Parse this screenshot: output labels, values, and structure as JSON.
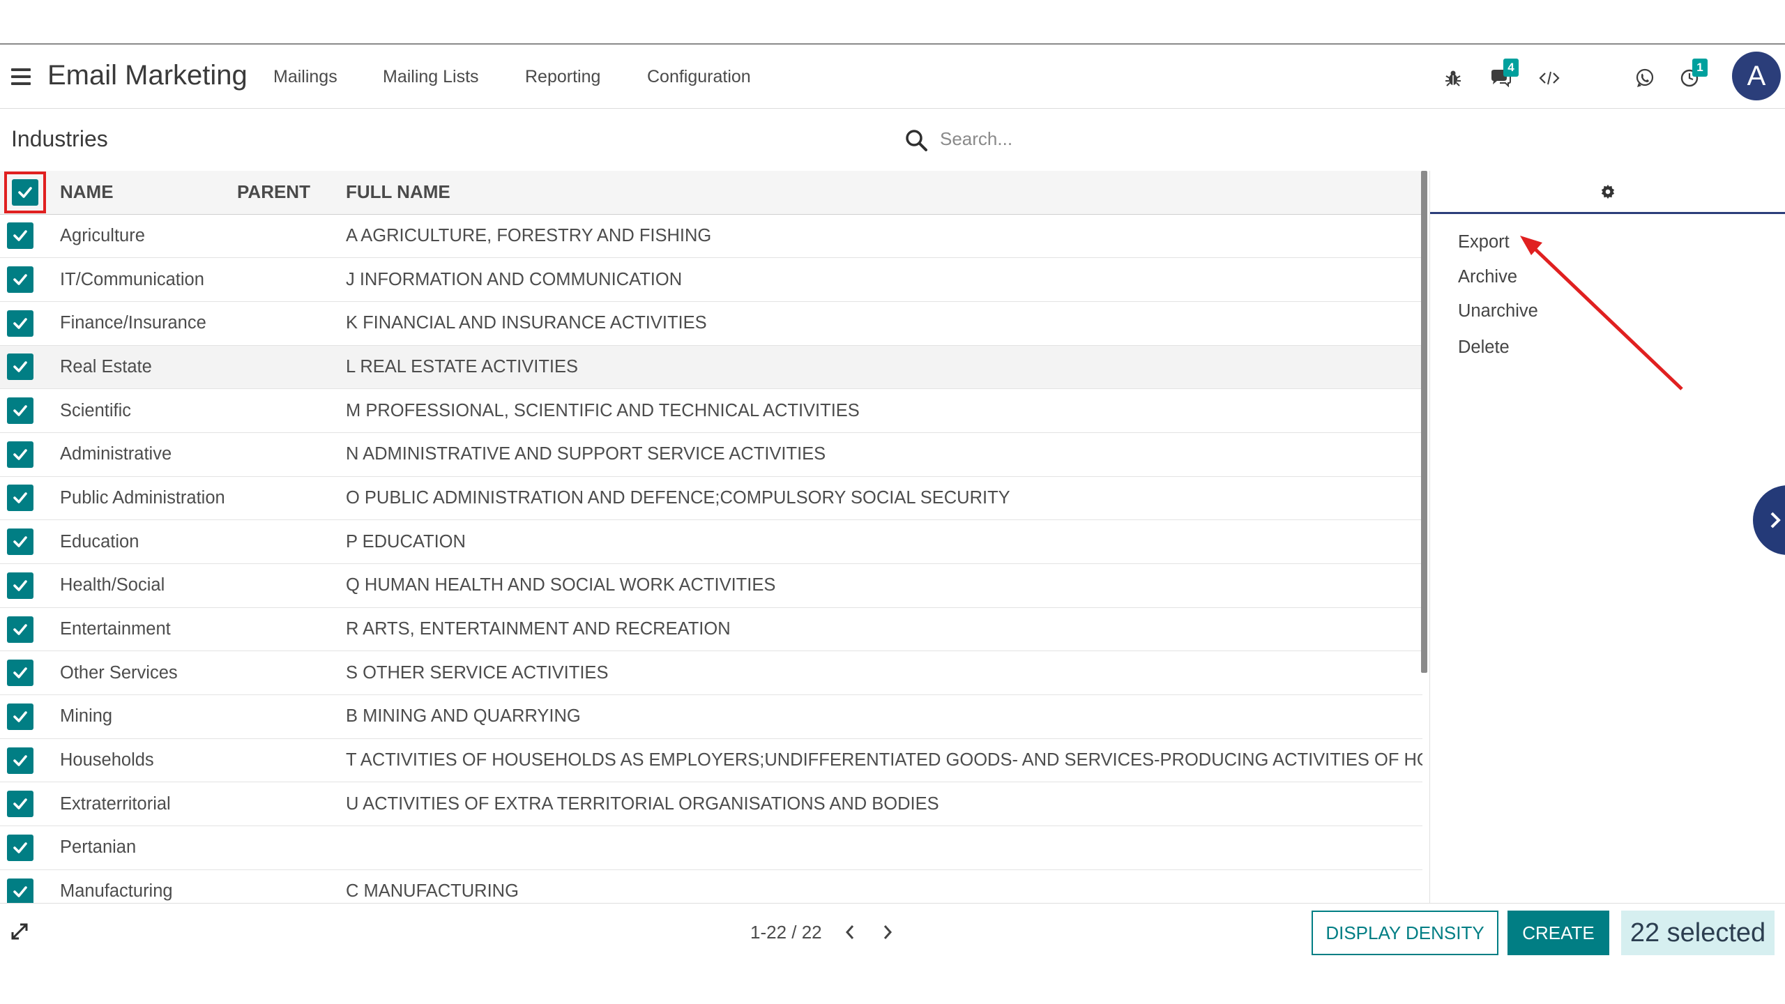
{
  "navbar": {
    "app_title": "Email Marketing",
    "menu": [
      "Mailings",
      "Mailing Lists",
      "Reporting",
      "Configuration"
    ],
    "chat_badge": "4",
    "activity_badge": "1",
    "avatar_letter": "A",
    "icons": [
      "bug-icon",
      "chat-icon",
      "code-icon",
      "whatsapp-icon",
      "clock-icon"
    ]
  },
  "control_panel": {
    "title": "Industries",
    "search_placeholder": "Search..."
  },
  "table": {
    "columns": [
      "NAME",
      "PARENT",
      "FULL NAME"
    ],
    "rows": [
      {
        "name": "Agriculture",
        "parent": "",
        "full_name": "A AGRICULTURE, FORESTRY AND FISHING"
      },
      {
        "name": "IT/Communication",
        "parent": "",
        "full_name": "J INFORMATION AND COMMUNICATION"
      },
      {
        "name": "Finance/Insurance",
        "parent": "",
        "full_name": "K FINANCIAL AND INSURANCE ACTIVITIES"
      },
      {
        "name": "Real Estate",
        "parent": "",
        "full_name": "L REAL ESTATE ACTIVITIES"
      },
      {
        "name": "Scientific",
        "parent": "",
        "full_name": "M PROFESSIONAL, SCIENTIFIC AND TECHNICAL ACTIVITIES"
      },
      {
        "name": "Administrative",
        "parent": "",
        "full_name": "N ADMINISTRATIVE AND SUPPORT SERVICE ACTIVITIES"
      },
      {
        "name": "Public Administration",
        "parent": "",
        "full_name": "O PUBLIC ADMINISTRATION AND DEFENCE;COMPULSORY SOCIAL SECURITY"
      },
      {
        "name": "Education",
        "parent": "",
        "full_name": "P EDUCATION"
      },
      {
        "name": "Health/Social",
        "parent": "",
        "full_name": "Q HUMAN HEALTH AND SOCIAL WORK ACTIVITIES"
      },
      {
        "name": "Entertainment",
        "parent": "",
        "full_name": "R ARTS, ENTERTAINMENT AND RECREATION"
      },
      {
        "name": "Other Services",
        "parent": "",
        "full_name": "S OTHER SERVICE ACTIVITIES"
      },
      {
        "name": "Mining",
        "parent": "",
        "full_name": "B MINING AND QUARRYING"
      },
      {
        "name": "Households",
        "parent": "",
        "full_name": "T ACTIVITIES OF HOUSEHOLDS AS EMPLOYERS;UNDIFFERENTIATED GOODS- AND SERVICES-PRODUCING ACTIVITIES OF HOUSEHOLDS FOR OWN USE"
      },
      {
        "name": "Extraterritorial",
        "parent": "",
        "full_name": "U ACTIVITIES OF EXTRA TERRITORIAL ORGANISATIONS AND BODIES"
      },
      {
        "name": "Pertanian",
        "parent": "",
        "full_name": ""
      },
      {
        "name": "Manufacturing",
        "parent": "",
        "full_name": "C MANUFACTURING"
      }
    ]
  },
  "action_menu": {
    "items": [
      "Export",
      "Archive",
      "Unarchive",
      "Delete"
    ]
  },
  "footer": {
    "pager": "1-22 / 22",
    "display_density_label": "DISPLAY DENSITY",
    "create_label": "CREATE",
    "selected_label": "22 selected"
  },
  "colors": {
    "accent": "#017e84",
    "avatar": "#2b3e7a",
    "badge": "#00a09d",
    "highlight_red": "#e02020"
  }
}
